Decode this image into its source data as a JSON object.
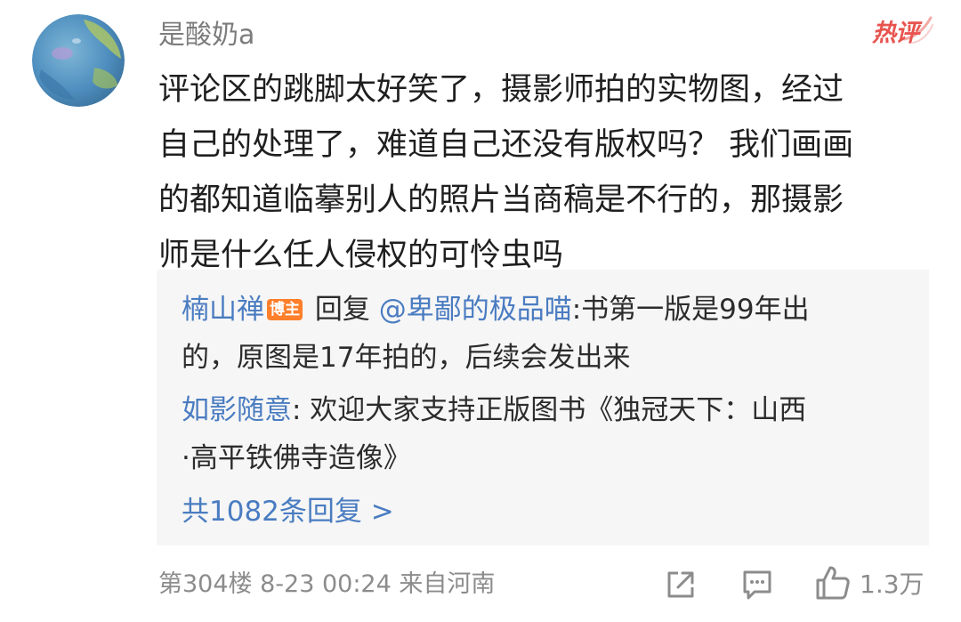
{
  "comment": {
    "username": "是酸奶a",
    "hot_badge": "热评",
    "body_lines": [
      "评论区的跳脚太好笑了，摄影师拍的实物图，经过",
      "自己的处理了，难道自己还没有版权吗？ 我们画画",
      "的都知道临摹别人的照片当商稿是不行的，那摄影",
      "师是什么任人侵权的可怜虫吗"
    ],
    "footer": {
      "meta": "第304楼 8-23 00:24 来自河南",
      "likes": "1.3万"
    }
  },
  "replies": {
    "items": [
      {
        "author": "楠山禅",
        "author_badge": "博主",
        "reply_word": " 回复 ",
        "mention": "@卑鄙的极品喵",
        "text_line1": ":书第一版是99年出",
        "text_line2": "的，原图是17年拍的，后续会发出来"
      },
      {
        "author": "如影随意",
        "text_line1": ": 欢迎大家支持正版图书《独冠天下：山西",
        "text_line2": "·高平铁佛寺造像》"
      }
    ],
    "more_label": "共1082条回复 >"
  },
  "colors": {
    "link": "#4a7cc1",
    "hot_badge": "#e8534f",
    "blogger_badge": "#ff7f2a",
    "reply_bg": "#f6f6f6",
    "meta_text": "#8c8c8c"
  },
  "icons": {
    "share": "share-icon",
    "comment": "comment-icon",
    "like": "thumbs-up-icon"
  }
}
